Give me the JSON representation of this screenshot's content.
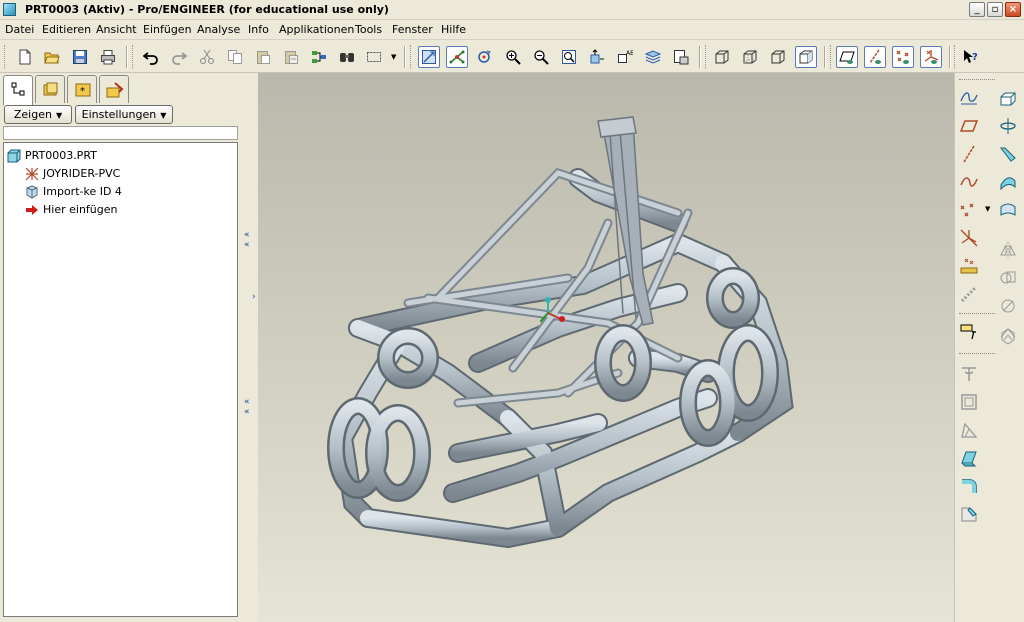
{
  "window": {
    "title": "PRT0003 (Aktiv) - Pro/ENGINEER (for educational use only)",
    "controls": [
      "minimize",
      "maximize",
      "close"
    ]
  },
  "menubar": {
    "items": [
      "Datei",
      "Editieren",
      "Ansicht",
      "Einfügen",
      "Analyse",
      "Info",
      "Applikationen",
      "Tools",
      "Fenster",
      "Hilfe"
    ]
  },
  "toolbar": {
    "buttons": [
      "new-icon",
      "open-icon",
      "save-icon",
      "print-icon",
      "undo-icon",
      "redo-icon",
      "cut-icon",
      "copy-icon",
      "paste-icon",
      "paste-special-icon",
      "regenerate-icon",
      "find-icon",
      "select-box-icon",
      "repaint-icon",
      "spin-center-icon",
      "orient-icon",
      "zoom-in-icon",
      "zoom-out-icon",
      "refit-icon",
      "view-manager-icon",
      "saved-views-icon",
      "layers-icon",
      "model-display-icon",
      "wireframe-icon",
      "hidden-line-icon",
      "no-hidden-icon",
      "shading-icon",
      "datum-plane-display-icon",
      "datum-axis-display-icon",
      "datum-point-display-icon",
      "csys-display-icon",
      "context-help-icon"
    ],
    "active": [
      "repaint-icon",
      "spin-center-icon",
      "shading-icon"
    ]
  },
  "left_panel": {
    "tabs": [
      "model-tree-tab",
      "folder-browser-tab",
      "favorites-tab",
      "connections-tab"
    ],
    "show_button": "Zeigen",
    "settings_button": "Einstellungen",
    "tree": [
      {
        "label": "PRT0003.PRT",
        "icon": "part-icon"
      },
      {
        "label": "JOYRIDER-PVC",
        "icon": "import-feature-icon"
      },
      {
        "label": "Import-ke ID 4",
        "icon": "import-geometry-icon"
      },
      {
        "label": "Hier einfügen",
        "icon": "insert-here-arrow-icon"
      }
    ]
  },
  "right_toolbar": {
    "left_column": [
      "sketch-icon",
      "plane-icon",
      "axis-icon",
      "curve-icon",
      "point-icon",
      "csys-icon",
      "analysis-icon",
      "datum-icon",
      "annotation-icon",
      "hole-icon",
      "shell-icon",
      "rib-icon",
      "draft-icon",
      "round-icon",
      "chamfer-icon"
    ],
    "right_column": [
      "extrude-icon",
      "revolve-icon",
      "sweep-icon",
      "blend-icon",
      "style-icon",
      "mirror-icon",
      "merge-icon",
      "trim-icon",
      "offset-icon",
      "solidify-icon"
    ]
  },
  "colors": {
    "chrome": "#ece9d8",
    "tube": "#b4bfc7",
    "viewport_top": "#b9b8ac",
    "viewport_bottom": "#e6e4d4"
  }
}
